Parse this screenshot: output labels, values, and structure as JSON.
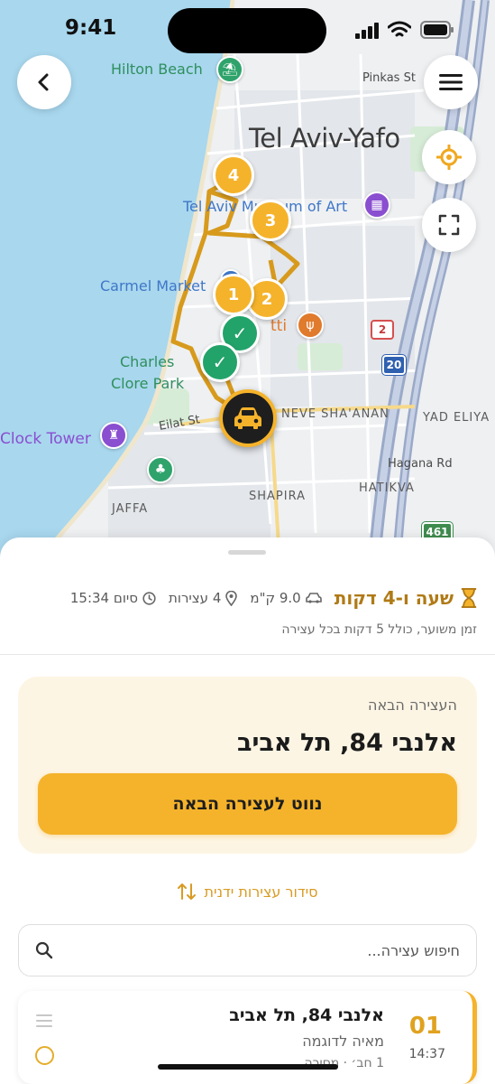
{
  "status_bar": {
    "time": "9:41"
  },
  "map": {
    "city_label": "Tel Aviv-Yafo",
    "poi_labels": {
      "hilton_beach": "Hilton Beach",
      "museum": "Tel Aviv Museum of Art",
      "carmel_market": "Carmel Market",
      "charles_clore_1": "Charles",
      "charles_clore_2": "Clore Park",
      "clock_tower": "Clock Tower",
      "restaurant_fragment": "tti"
    },
    "street_labels": {
      "pinkas": "Pinkas St",
      "eilat": "Eilat St",
      "hagana": "Hagana Rd"
    },
    "area_labels": {
      "neve_shaanan": "NEVE SHA'ANAN",
      "yad_eliyahu": "YAD ELIYA",
      "shapira": "SHAPIRA",
      "hatikva": "HATIKVA",
      "jaffa": "JAFFA"
    },
    "road_shields": [
      "2",
      "20",
      "461"
    ],
    "stop_markers": [
      "1",
      "2",
      "3",
      "4"
    ],
    "icons": [
      "chevron-left-icon",
      "menu-icon",
      "locate-icon",
      "fit-bounds-icon",
      "car-icon",
      "check-icon"
    ],
    "colors": {
      "route": "#d79a1c",
      "accent": "#f5b32b",
      "done": "#22a369",
      "water": "#a8d7ee"
    }
  },
  "summary": {
    "duration": "שעה ו-4 דקות",
    "distance": "9.0 ק\"מ",
    "stops": "4 עצירות",
    "end": "סיום 15:34",
    "note": "זמן משוער, כולל 5 דקות בכל עצירה"
  },
  "next_stop": {
    "caption": "העצירה הבאה",
    "address": "אלנבי 84, תל אביב",
    "button_label": "נווט לעצירה הבאה"
  },
  "manual_order_label": "סידור עצירות ידנית",
  "search": {
    "placeholder": "חיפוש עצירה..."
  },
  "stop_list": [
    {
      "number": "01",
      "time": "14:37",
      "address": "אלנבי 84, תל אביב",
      "customer": "מאיה לדוגמה",
      "meta": "1 חב׳ · מסירה"
    }
  ]
}
